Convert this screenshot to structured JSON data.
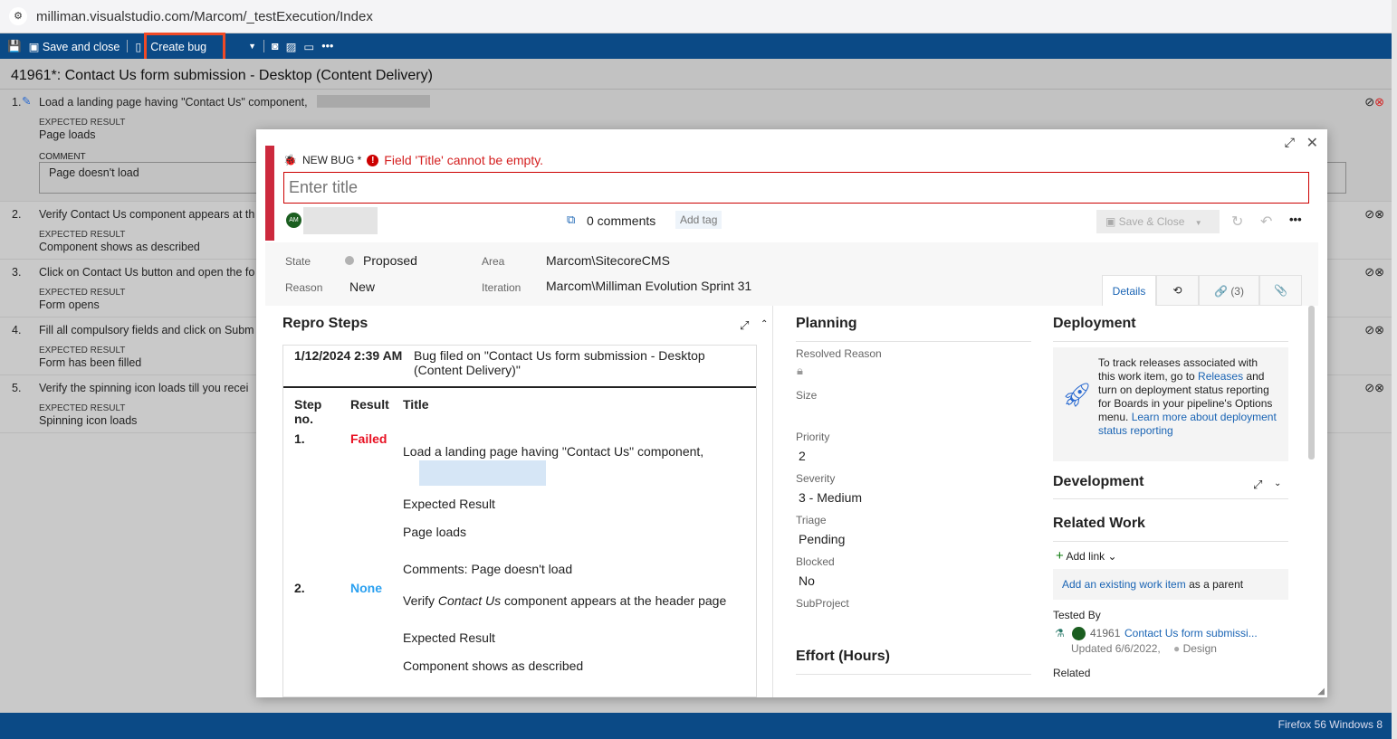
{
  "browser": {
    "url": "milliman.visualstudio.com/Marcom/_testExecution/Index"
  },
  "toolbar": {
    "save_close": "Save and close",
    "create_bug": "Create bug"
  },
  "test_case": {
    "title": "41961*: Contact Us form submission - Desktop (Content Delivery)",
    "expected_label": "EXPECTED RESULT",
    "comment_label": "COMMENT",
    "steps": [
      {
        "num": "1.",
        "text": "Load a landing page having \"Contact Us\" component,",
        "expected": "Page loads",
        "comment": "Page doesn't load"
      },
      {
        "num": "2.",
        "text": "Verify Contact Us component appears at th",
        "expected": "Component shows as described"
      },
      {
        "num": "3.",
        "text": "Click on Contact Us button and open the fo",
        "expected": "Form opens"
      },
      {
        "num": "4.",
        "text": "Fill all compulsory fields and click on Subm",
        "expected": "Form has been filled"
      },
      {
        "num": "5.",
        "text": "Verify the spinning icon loads till you recei",
        "expected": "Spinning icon loads"
      }
    ]
  },
  "status_bar": "Firefox 56 Windows 8",
  "bug": {
    "type": "NEW BUG *",
    "error": "Field 'Title' cannot be empty.",
    "title_placeholder": "Enter title",
    "avatar": "AM",
    "comments": "0 comments",
    "add_tag": "Add tag",
    "save_close": "Save & Close",
    "state_label": "State",
    "state": "Proposed",
    "reason_label": "Reason",
    "reason": "New",
    "area_label": "Area",
    "area": "Marcom\\SitecoreCMS",
    "iteration_label": "Iteration",
    "iteration": "Marcom\\Milliman Evolution Sprint 31",
    "tabs": {
      "details": "Details",
      "links": "(3)"
    },
    "repro": {
      "title": "Repro Steps",
      "date": "1/12/2024 2:39 AM",
      "filed": "Bug filed on \"Contact Us form submission - Desktop (Content Delivery)\"",
      "col_step": "Step no.",
      "col_result": "Result",
      "col_title": "Title",
      "s1_num": "1.",
      "s1_result": "Failed",
      "s1_title": "Load a landing page having \"Contact Us\" component,",
      "s1_exp_label": "Expected Result",
      "s1_exp": "Page loads",
      "s1_comment": "Comments: Page doesn't load",
      "s2_num": "2.",
      "s2_result": "None",
      "s2_title_a": "Verify ",
      "s2_title_i": "Contact Us",
      "s2_title_b": " component appears at the header page",
      "s2_exp_label": "Expected Result",
      "s2_exp": "Component shows as described"
    },
    "planning": {
      "title": "Planning",
      "resolved_reason": "Resolved Reason",
      "size": "Size",
      "priority_label": "Priority",
      "priority": "2",
      "severity_label": "Severity",
      "severity": "3 - Medium",
      "triage_label": "Triage",
      "triage": "Pending",
      "blocked_label": "Blocked",
      "blocked": "No",
      "subproject": "SubProject",
      "effort": "Effort (Hours)"
    },
    "deployment": {
      "title": "Deployment",
      "text1": "To track releases associated with this work item, go to ",
      "releases": "Releases",
      "text2": " and turn on deployment status reporting for Boards in your pipeline's Options menu. ",
      "learn": "Learn more about deployment status reporting"
    },
    "development": {
      "title": "Development"
    },
    "related": {
      "title": "Related Work",
      "add_link": "Add link",
      "add_existing": "Add an existing work item",
      "as_parent": " as a parent",
      "tested_by": "Tested By",
      "item_id": "41961",
      "item_title": "Contact Us form submissi...",
      "updated": "Updated 6/6/2022,",
      "item_state": "Design",
      "related": "Related"
    }
  }
}
